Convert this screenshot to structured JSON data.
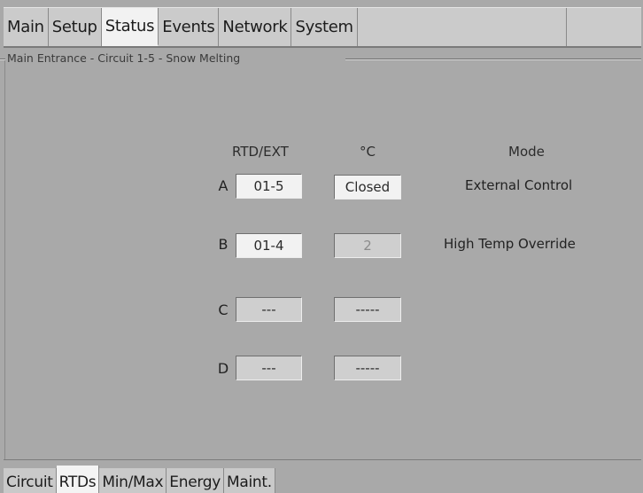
{
  "top_tabs": [
    {
      "label": "Main",
      "active": false
    },
    {
      "label": "Setup",
      "active": false
    },
    {
      "label": "Status",
      "active": true
    },
    {
      "label": "Events",
      "active": false
    },
    {
      "label": "Network",
      "active": false
    },
    {
      "label": "System",
      "active": false
    }
  ],
  "group": {
    "title": "Main Entrance - Circuit 1-5 - Snow Melting"
  },
  "headers": {
    "rtd": "RTD/EXT",
    "temp": "°C",
    "mode": "Mode"
  },
  "rows": [
    {
      "label": "A",
      "rtd": "01-5",
      "temp": "Closed",
      "mode": "External Control"
    },
    {
      "label": "B",
      "rtd": "01-4",
      "temp": "2",
      "mode": "High Temp Override"
    },
    {
      "label": "C",
      "rtd": "---",
      "temp": "-----",
      "mode": ""
    },
    {
      "label": "D",
      "rtd": "---",
      "temp": "-----",
      "mode": ""
    }
  ],
  "bottom_tabs": [
    {
      "label": "Circuit",
      "active": false
    },
    {
      "label": "RTDs",
      "active": true
    },
    {
      "label": "Min/Max",
      "active": false
    },
    {
      "label": "Energy",
      "active": false
    },
    {
      "label": "Maint.",
      "active": false
    }
  ],
  "colors": {
    "background": "#a9a9a9",
    "tab_bar": "#c9c9c9",
    "active_tab": "#f2f2f2"
  }
}
